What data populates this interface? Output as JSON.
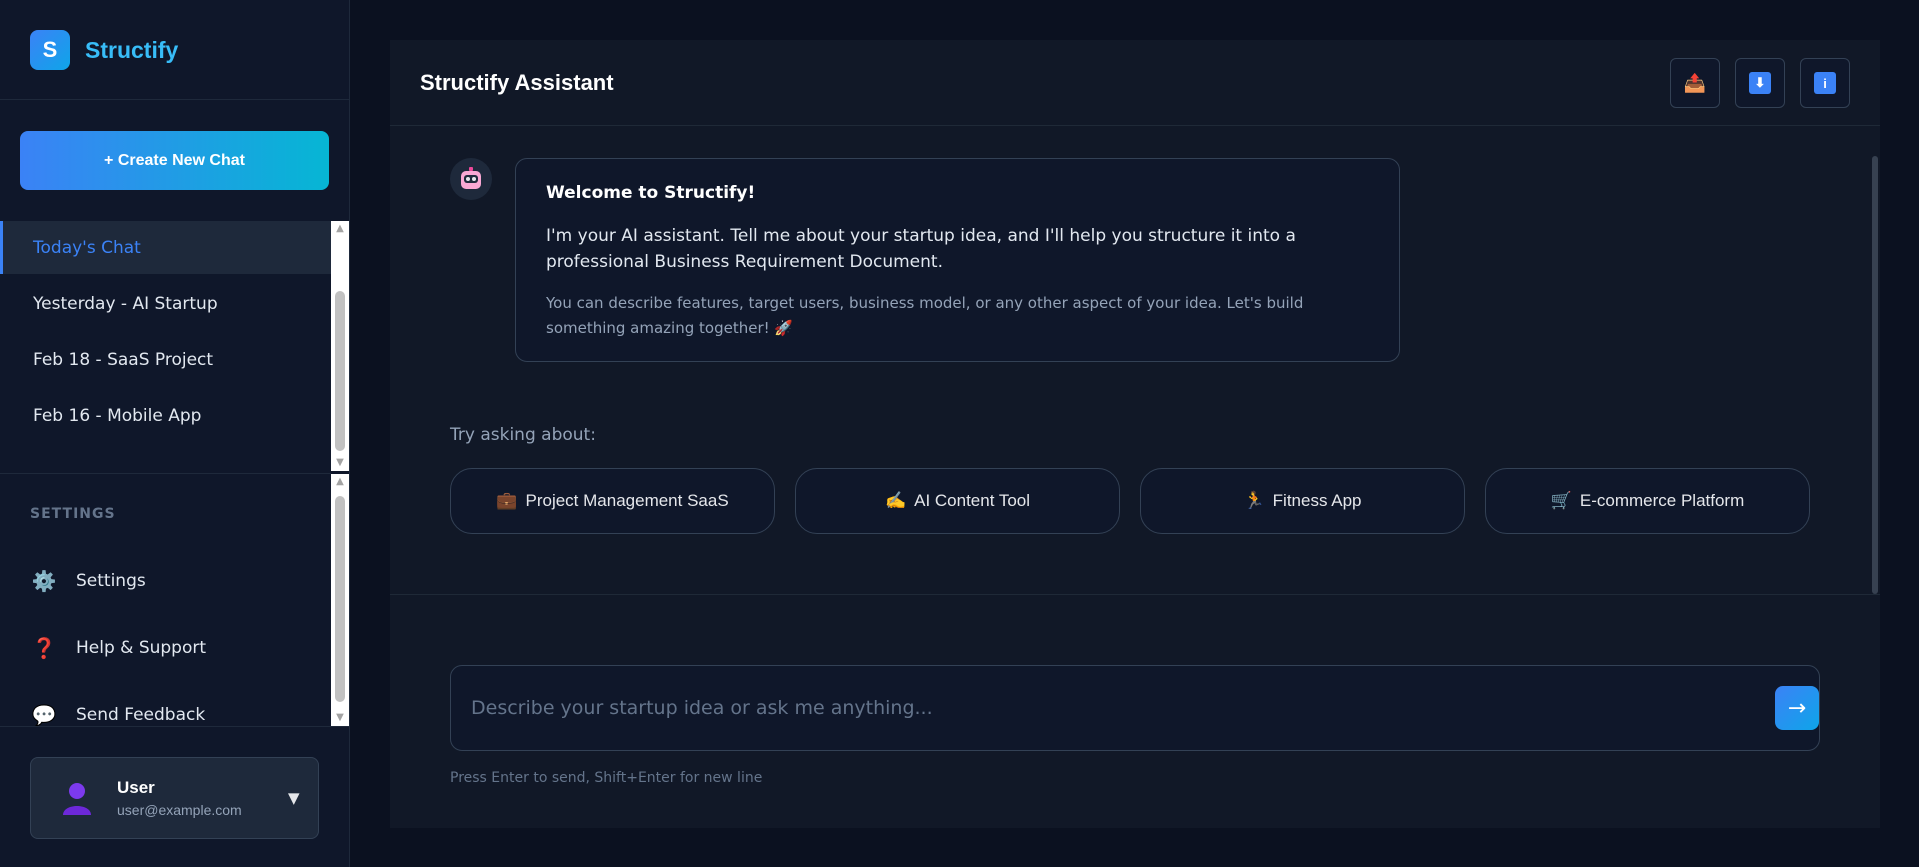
{
  "brand": {
    "logo_letter": "S",
    "name": "Structify"
  },
  "sidebar": {
    "new_chat_label": "+ Create New Chat",
    "chats": [
      {
        "label": "Today's Chat",
        "active": true
      },
      {
        "label": "Yesterday - AI Startup",
        "active": false
      },
      {
        "label": "Feb 18 - SaaS Project",
        "active": false
      },
      {
        "label": "Feb 16 - Mobile App",
        "active": false
      }
    ],
    "settings_title": "SETTINGS",
    "settings_items": [
      {
        "label": "Settings",
        "icon": "gear-icon",
        "glyph": "⚙️"
      },
      {
        "label": "Help & Support",
        "icon": "question-icon",
        "glyph": "❓"
      },
      {
        "label": "Send Feedback",
        "icon": "speech-bubble-icon",
        "glyph": "💬"
      }
    ]
  },
  "user": {
    "name": "User",
    "email": "user@example.com",
    "caret": "▼"
  },
  "main": {
    "title": "Structify Assistant",
    "header_buttons": [
      {
        "name": "share-button",
        "icon": "share-icon",
        "glyph": "📤"
      },
      {
        "name": "download-button",
        "icon": "download-icon",
        "glyph": "⬇"
      },
      {
        "name": "info-button",
        "icon": "info-icon",
        "glyph": "i"
      }
    ],
    "welcome": {
      "title": "Welcome to Structify!",
      "body": "I'm your AI assistant. Tell me about your startup idea, and I'll help you structure it into a professional Business Requirement Document.",
      "note": "You can describe features, target users, business model, or any other aspect of your idea. Let's build something amazing together! 🚀"
    },
    "try_label": "Try asking about:",
    "suggestions": [
      {
        "emoji": "💼",
        "label": "Project Management SaaS"
      },
      {
        "emoji": "✍️",
        "label": "AI Content Tool"
      },
      {
        "emoji": "🏃",
        "label": "Fitness App"
      },
      {
        "emoji": "🛒",
        "label": "E-commerce Platform"
      }
    ],
    "input_placeholder": "Describe your startup idea or ask me anything...",
    "send_glyph": "→",
    "hint": "Press Enter to send, Shift+Enter for new line"
  },
  "colors": {
    "accent": "#3b82f6",
    "accent2": "#06b6d4",
    "background": "#0b1120",
    "panel": "#111827"
  }
}
